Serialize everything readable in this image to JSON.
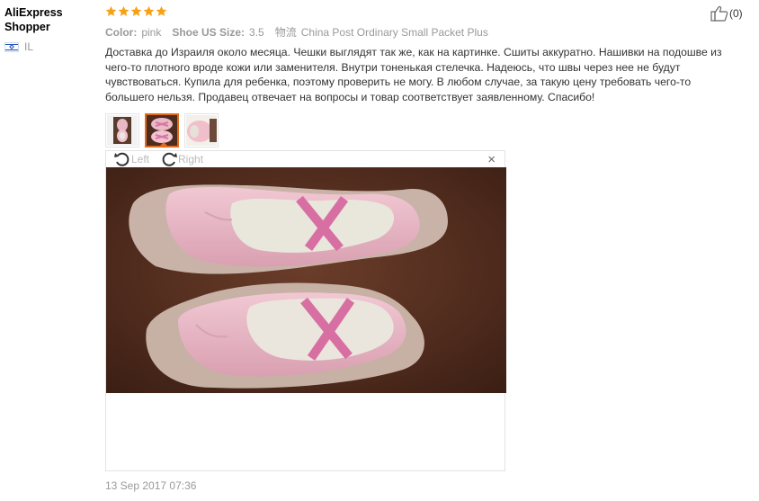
{
  "reviewer": {
    "name": "AliExpress\nShopper",
    "country_code": "IL",
    "flag_icon": "israel-flag-icon"
  },
  "review": {
    "rating": 5,
    "star_color": "#f7a216",
    "attributes": [
      {
        "label": "Color:",
        "value": "pink"
      },
      {
        "label": "Shoe US Size:",
        "value": "3.5"
      },
      {
        "label": "物流",
        "value": "China Post Ordinary Small Packet Plus"
      }
    ],
    "text": "Доставка до Израиля около месяца. Чешки выглядят так же, как на картинке. Сшиты аккуратно. Нашивки на подошве из чего-то плотного вроде кожи или заменителя. Внутри тоненькая стелечка. Надеюсь, что швы через нее не будут чувствоваться. Купила для ребенка, поэтому проверить не могу. В любом случае, за такую цену требовать чего-то большего нельзя. Продавец отвечает на вопросы и товар соответствует заявленному. Спасибо!",
    "date": "13 Sep 2017 07:36"
  },
  "viewer": {
    "rotate_left_label": "Left",
    "rotate_right_label": "Right",
    "close_glyph": "×",
    "thumbnails": [
      {
        "name": "thumbnail-1",
        "active": false
      },
      {
        "name": "thumbnail-2",
        "active": true
      },
      {
        "name": "thumbnail-3",
        "active": false
      }
    ]
  },
  "like": {
    "count_label": "(0)",
    "icon": "thumbs-up-icon"
  },
  "colors": {
    "accent": "#e46b1c",
    "muted": "#999999",
    "text": "#333333"
  }
}
